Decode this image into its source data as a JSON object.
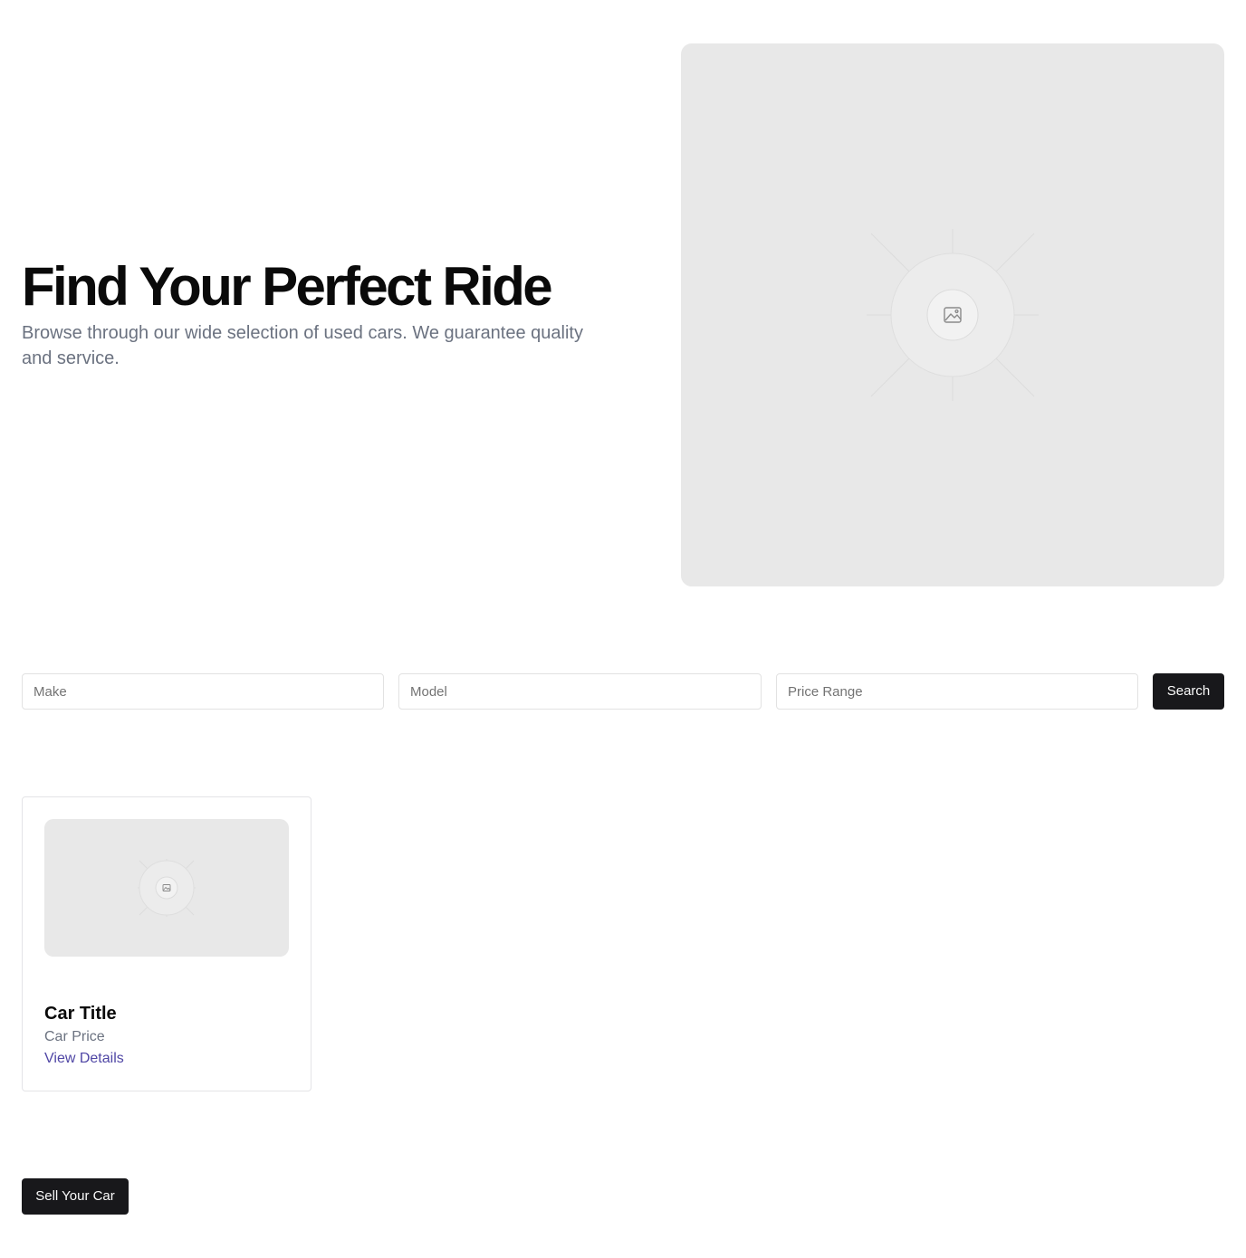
{
  "hero": {
    "title": "Find Your Perfect Ride",
    "subtitle": "Browse through our wide selection of used cars. We guarantee quality and service.",
    "image_icon": "image-placeholder-icon"
  },
  "search": {
    "make_placeholder": "Make",
    "model_placeholder": "Model",
    "price_placeholder": "Price Range",
    "button_label": "Search"
  },
  "listings": [
    {
      "image_icon": "image-placeholder-icon",
      "title": "Car Title",
      "price": "Car Price",
      "link_label": "View Details"
    }
  ],
  "actions": {
    "sell_label": "Sell Your Car"
  },
  "colors": {
    "primary_button": "#18181b",
    "link": "#4f46a5",
    "muted_text": "#6b7280",
    "placeholder_bg": "#e8e8e8"
  }
}
